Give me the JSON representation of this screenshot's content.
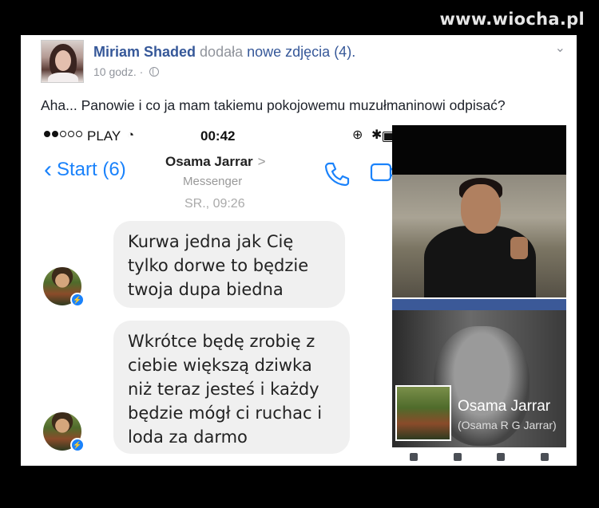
{
  "watermark": "www.wiocha.pl",
  "post": {
    "author": "Miriam Shaded",
    "action": "dodała",
    "photos_link": "nowe zdjęcia (4).",
    "time": "10 godz. ·",
    "text": "Aha... Panowie i co ja mam takiemu pokojowemu muzułmaninowi odpisać?"
  },
  "phone": {
    "status": {
      "carrier": "PLAY",
      "time": "00:42"
    },
    "nav": {
      "back_label": "Start (6)",
      "contact_name": "Osama Jarrar",
      "contact_sub": "Messenger"
    },
    "date_separator": "SR., 09:26",
    "messages": [
      {
        "text": "Kurwa jedna jak Cię tylko dorwe to będzie twoja dupa biedna"
      },
      {
        "text": "Wkrótce będę zrobię z ciebie większą dziwka niż teraz jesteś i każdy będzie mógł ci ruchac i loda za darmo"
      }
    ]
  },
  "profile_card": {
    "name": "Osama Jarrar",
    "subname": "(Osama R G Jarrar)"
  },
  "colors": {
    "link": "#365899",
    "ios_blue": "#1a82fb",
    "fb_blue": "#3b5998"
  }
}
